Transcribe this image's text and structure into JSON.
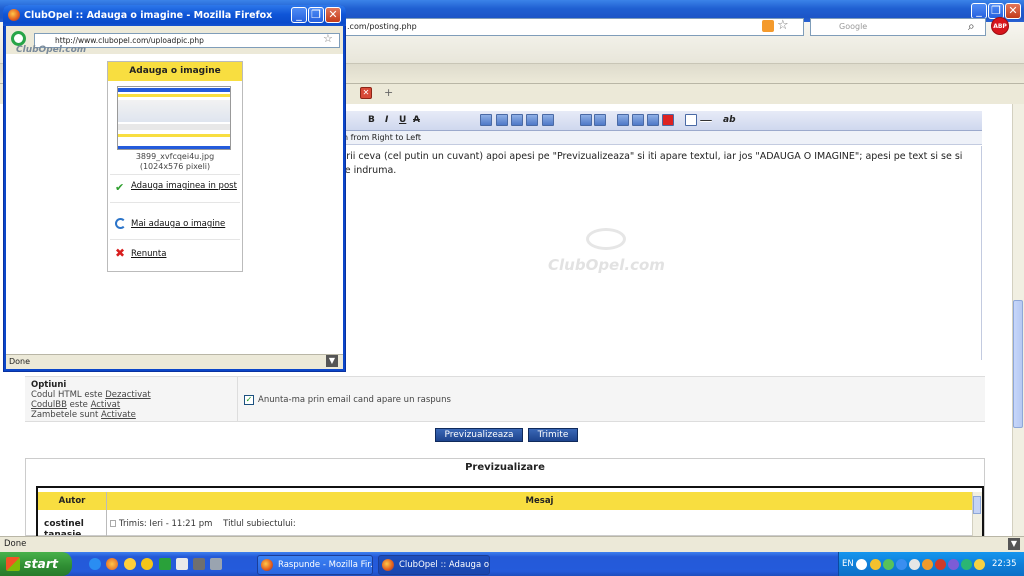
{
  "main_window": {
    "url_fragment": ".com/posting.php",
    "search_placeholder": "Google",
    "abp_label": "ABP",
    "rtl_label": "n from Right to Left",
    "editor_toolbar": {
      "bold": "B",
      "italic": "I",
      "underline": "U",
      "strike": "A",
      "ab": "ab"
    },
    "editor_text": "crii ceva (cel putin un cuvant) apoi apesi pe \"Previzualizeaza\" si iti apare textul, iar jos \"ADAUGA O IMAGINE\"; apesi pe text si se si te indruma.",
    "watermark": "ClubOpel.com",
    "options": {
      "title": "Optiuni",
      "html_line_prefix": "Codul HTML este ",
      "html_line_value": "Dezactivat",
      "bb_line_prefix": "CodulBB",
      "bb_line_mid": " este ",
      "bb_line_value": "Activat",
      "smiley_line_prefix": "Zambetele sunt ",
      "smiley_line_value": "Activate",
      "notify_label": "Anunta-ma prin email cand apare un raspuns"
    },
    "buttons": {
      "preview": "Previzualizeaza",
      "submit": "Trimite"
    },
    "preview": {
      "title": "Previzualizare",
      "col_author": "Autor",
      "col_message": "Mesaj",
      "author": "costinel tanasie",
      "meta": "Trimis: Ieri - 11:21 pm    Titlul subiectului:"
    },
    "status": "Done"
  },
  "popup_window": {
    "title": "ClubOpel :: Adauga o imagine - Mozilla Firefox",
    "url": "http://www.clubopel.com/uploadpic.php",
    "logo_text": "ClubOpel.com",
    "panel": {
      "header": "Adauga o imagine",
      "filename": "3899_xvfcqei4u.jpg",
      "dimensions": "(1024x576 pixeli)",
      "add_to_post": "Adauga imaginea in post",
      "add_another": "Mai adauga o imagine",
      "cancel": "Renunta"
    },
    "status": "Done"
  },
  "taskbar": {
    "start_label": "start",
    "tasks": [
      {
        "label": "Raspunde - Mozilla Fir..."
      },
      {
        "label": "ClubOpel :: Adauga o..."
      }
    ],
    "lang": "EN",
    "clock": "22:35"
  },
  "colors": {
    "xp_blue": "#245bdb",
    "accent_yellow": "#f8de40",
    "button_blue": "#1d438d",
    "start_green": "#2f8d33"
  }
}
